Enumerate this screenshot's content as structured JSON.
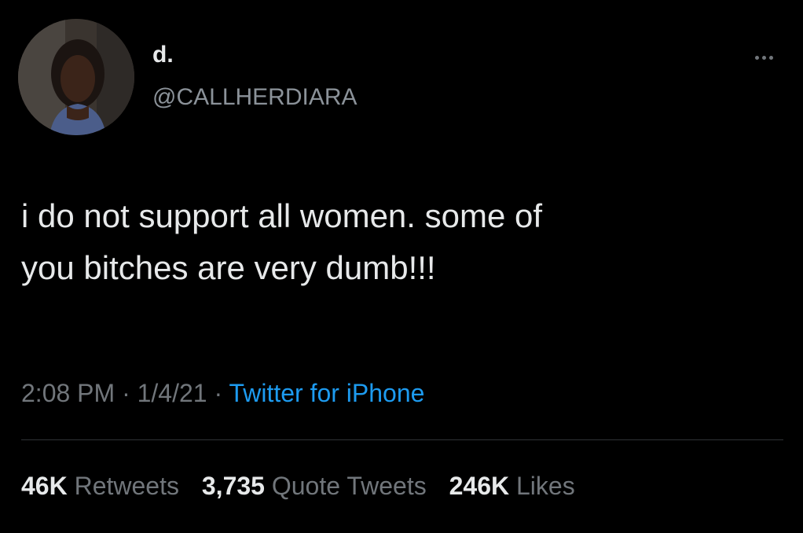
{
  "profile": {
    "display_name": "d.",
    "handle": "@CALLHERDIARA",
    "avatar_icon": "profile-photo"
  },
  "tweet": {
    "lines": [
      "i do not support all women. some of",
      "you bitches are very dumb!!!"
    ],
    "time": "2:08 PM",
    "date": "1/4/21",
    "source": "Twitter for iPhone",
    "separator": " · "
  },
  "stats": {
    "retweets_count": "46K",
    "retweets_label": "Retweets",
    "quotes_count": "3,735",
    "quotes_label": "Quote Tweets",
    "likes_count": "246K",
    "likes_label": "Likes"
  },
  "icons": {
    "more": "more-dots-icon"
  },
  "colors": {
    "background": "#000000",
    "text": "#e7e9ea",
    "secondary": "#71767b",
    "link": "#1d9bf0"
  }
}
